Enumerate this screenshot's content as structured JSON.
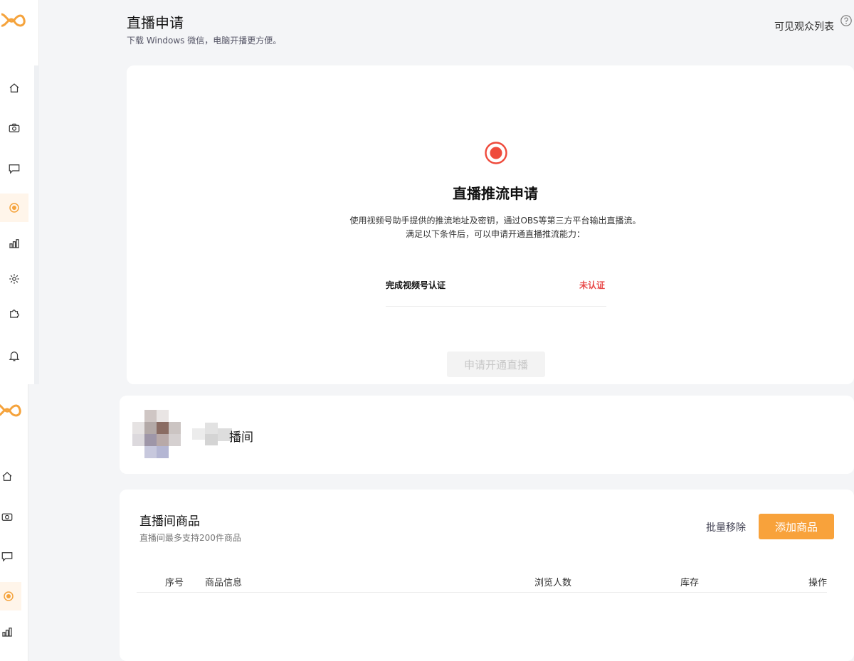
{
  "header": {
    "title": "直播申请",
    "subtitle": "下载 Windows 微信，电脑开播更方便。",
    "viewer_list": "可见观众列表"
  },
  "push_card": {
    "title": "直播推流申请",
    "desc_line1": "使用视频号助手提供的推流地址及密钥，通过OBS等第三方平台输出直播流。",
    "desc_line2": "满足以下条件后，可以申请开通直播推流能力：",
    "condition_label": "完成视频号认证",
    "condition_status": "未认证",
    "apply_button": "申请开通直播"
  },
  "room": {
    "name_suffix": "播间"
  },
  "products": {
    "title": "直播间商品",
    "subtitle": "直播间最多支持200件商品",
    "batch_remove": "批量移除",
    "add_button": "添加商品",
    "columns": [
      "序号",
      "商品信息",
      "浏览人数",
      "库存",
      "操作"
    ]
  },
  "colors": {
    "accent": "#f8a23b",
    "live_red": "#ef4b3c",
    "status_red": "#e84a4a"
  }
}
